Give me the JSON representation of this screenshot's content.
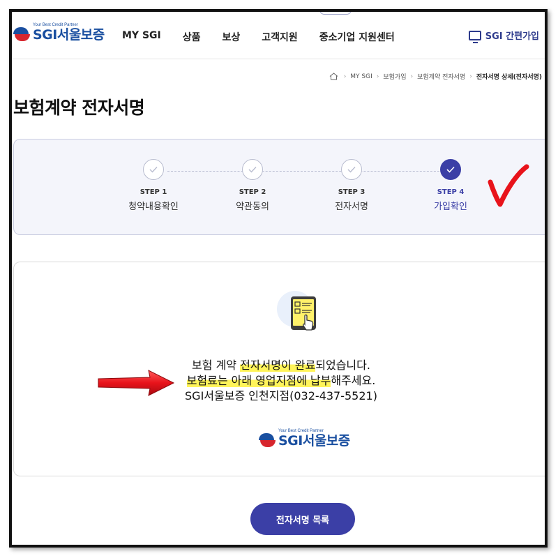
{
  "brand": {
    "tagline": "Your Best Credit Partner",
    "name": "SGI서울보증"
  },
  "nav": {
    "items": [
      "MY SGI",
      "상품",
      "보상",
      "고객지원",
      "중소기업 지원센터"
    ]
  },
  "quick_join": {
    "label": "SGI 간편가입",
    "icon": "computer-icon"
  },
  "breadcrumb": {
    "items": [
      "MY SGI",
      "보험가입",
      "보험계약 전자서명"
    ],
    "current": "전자서명 상세(전자서명)"
  },
  "page_title": "보험계약 전자서명",
  "steps": [
    {
      "num": "STEP 1",
      "label": "청약내용확인",
      "status": "done"
    },
    {
      "num": "STEP 2",
      "label": "약관동의",
      "status": "done"
    },
    {
      "num": "STEP 3",
      "label": "전자서명",
      "status": "done"
    },
    {
      "num": "STEP 4",
      "label": "가입확인",
      "status": "active"
    }
  ],
  "message": {
    "line1_pre": "보험 계약 ",
    "line1_hl": "전자서명이 완료",
    "line1_post": "되었습니다.",
    "line2_hl": "보험료는 아래 영업지점에 납부",
    "line2_post": "해주세요.",
    "line3": "SGI서울보증 인천지점(032-437-5521)"
  },
  "card_logo": {
    "tagline": "Your Best Credit Partner",
    "name": "SGI서울보증"
  },
  "list_button": {
    "label": "전자서명 목록"
  },
  "colors": {
    "brand_blue": "#1a4fa0",
    "brand_red": "#d7262e",
    "accent": "#3b3fa6",
    "highlight": "#fff45a",
    "annotation_red": "#e8131b"
  }
}
